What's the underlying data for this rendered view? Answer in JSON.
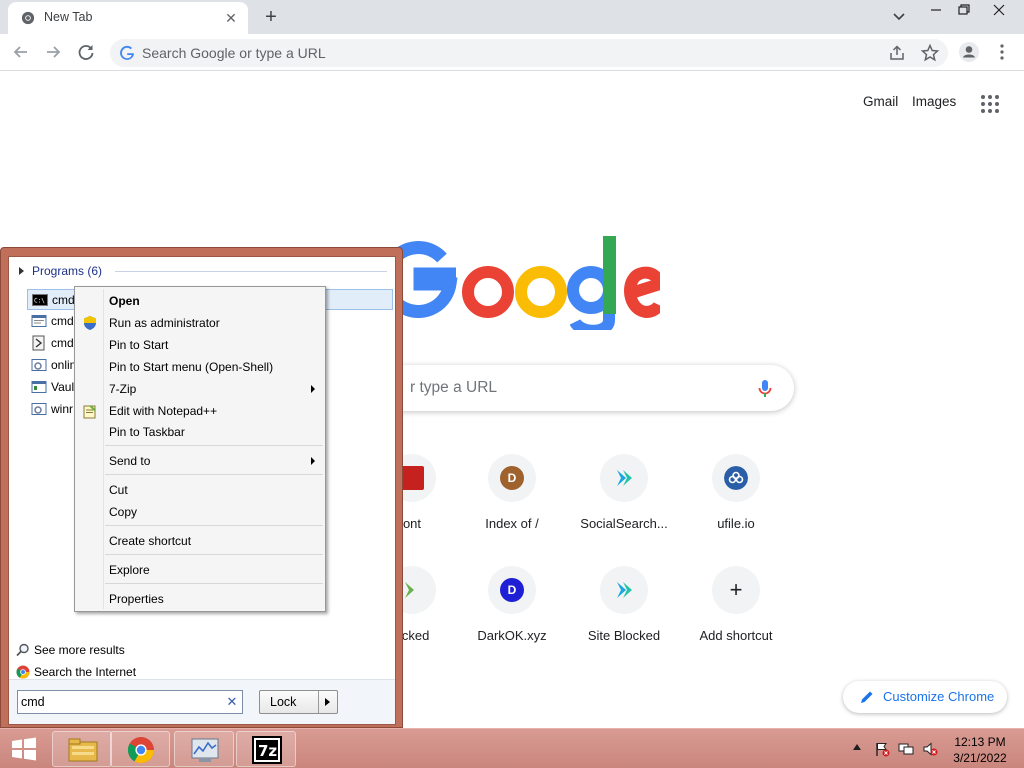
{
  "browser": {
    "tab_title": "New Tab",
    "omnibox_placeholder": "Search Google or type a URL"
  },
  "ntp": {
    "gmail_label": "Gmail",
    "images_label": "Images",
    "search_placeholder_visible": "r type a URL",
    "shortcuts": [
      {
        "label": "ont",
        "letter": "",
        "color": "#c5221f"
      },
      {
        "label": "Index of /",
        "letter": "D",
        "color": "#a0622d"
      },
      {
        "label": "SocialSearch...",
        "letter": "",
        "color": "#1db9a6"
      },
      {
        "label": "ufile.io",
        "letter": "",
        "color": "#2a5fa8"
      },
      {
        "label": "ocked",
        "letter": "",
        "color": "#6ab04c"
      },
      {
        "label": "DarkOK.xyz",
        "letter": "D",
        "color": "#1f1fd6"
      },
      {
        "label": "Site Blocked",
        "letter": "",
        "color": "#1db9a6"
      },
      {
        "label": "Add shortcut",
        "letter": "+",
        "color": ""
      }
    ],
    "customize_label": "Customize Chrome"
  },
  "start_menu": {
    "programs_header": "Programs (6)",
    "programs": [
      {
        "label": "cmd",
        "icon": "console-icon"
      },
      {
        "label": "cmd",
        "icon": "window-icon"
      },
      {
        "label": "cmd",
        "icon": "script-icon"
      },
      {
        "label": "onlin",
        "icon": "settings-icon"
      },
      {
        "label": "Vault",
        "icon": "window-icon"
      },
      {
        "label": "winr",
        "icon": "settings-icon"
      }
    ],
    "see_more_label": "See more results",
    "search_internet_label": "Search the Internet",
    "search_value": "cmd",
    "lock_label": "Lock"
  },
  "context_menu": {
    "items": [
      {
        "label": "Open"
      },
      {
        "label": "Run as administrator"
      },
      {
        "label": "Pin to Start"
      },
      {
        "label": "Pin to Start menu (Open-Shell)"
      },
      {
        "label": "7-Zip"
      },
      {
        "label": "Edit with Notepad++"
      },
      {
        "label": "Pin to Taskbar"
      },
      {
        "label": "Send to"
      },
      {
        "label": "Cut"
      },
      {
        "label": "Copy"
      },
      {
        "label": "Create shortcut"
      },
      {
        "label": "Explore"
      },
      {
        "label": "Properties"
      }
    ]
  },
  "taskbar": {
    "time": "12:13 PM",
    "date": "3/21/2022"
  }
}
